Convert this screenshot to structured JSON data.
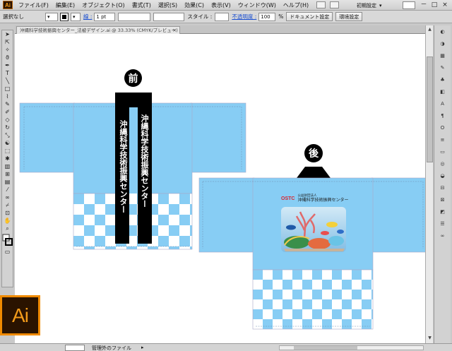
{
  "app": {
    "logo": "Ai",
    "menu": [
      "ファイル(F)",
      "編集(E)",
      "オブジェクト(O)",
      "書式(T)",
      "選択(S)",
      "効果(C)",
      "表示(V)",
      "ウィンドウ(W)",
      "ヘルプ(H)"
    ],
    "workspace": "初期設定",
    "window_buttons": [
      "－",
      "□",
      "×"
    ]
  },
  "control_bar": {
    "selection": "選択なし",
    "stroke_label": "線 :",
    "stroke_value": "1 pt",
    "style_label": "スタイル :",
    "opacity_label": "不透明度 :",
    "opacity_value": "100",
    "opacity_unit": "%",
    "document_setup": "ドキュメント設定",
    "preferences": "環境設定"
  },
  "document": {
    "tab_title": "沖縄科学技術振興センター_法被デザイン.ai @ 33.33% (CMYK/プレビュー)",
    "tab_close": "×"
  },
  "tools": [
    "selection-tool",
    "direct-selection-tool",
    "magic-wand-tool",
    "lasso-tool",
    "pen-tool",
    "type-tool",
    "line-tool",
    "rectangle-tool",
    "paintbrush-tool",
    "pencil-tool",
    "blob-brush-tool",
    "eraser-tool",
    "rotate-tool",
    "scale-tool",
    "warp-tool",
    "free-transform-tool",
    "symbol-sprayer-tool",
    "graph-tool",
    "mesh-tool",
    "gradient-tool",
    "eyedropper-tool",
    "blend-tool",
    "slice-tool",
    "artboard-tool",
    "hand-tool",
    "zoom-tool",
    "fill-stroke-swatch",
    "screen-mode"
  ],
  "panels": [
    "color-panel",
    "color-guide-panel",
    "swatches-panel",
    "brushes-panel",
    "symbols-panel",
    "graphic-styles-panel",
    "character-panel",
    "paragraph-panel",
    "opentype-panel",
    "stroke-panel",
    "gradient-panel",
    "transparency-panel",
    "appearance-panel",
    "align-panel",
    "transform-panel",
    "pathfinder-panel",
    "layers-panel",
    "links-panel"
  ],
  "artwork": {
    "front_label": "前",
    "back_label": "後",
    "collar_text_left": "沖縄科学技術振興センター",
    "collar_text_right": "沖縄科学技術振興センター",
    "back_logo_mark": "OSTC",
    "back_logo_small": "公益財団法人",
    "back_logo_name": "沖縄科学技術振興センター",
    "colors": {
      "body": "#87cdf4",
      "checker_light": "#ffffff",
      "checker_dark": "#87cdf4",
      "collar": "#000000"
    }
  },
  "status_bar": {
    "zoom": "33.33%",
    "status_text": "管理外のファイル"
  }
}
